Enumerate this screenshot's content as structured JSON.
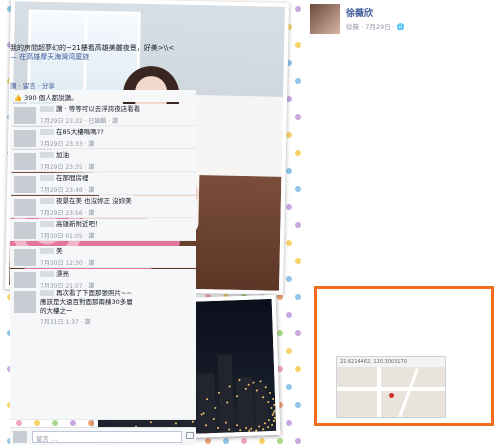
{
  "post": {
    "author": "徐薇欣",
    "meta": "徐薇 · 7月29日 · 🌐",
    "text": "我的房間超夢幻的~21樓看高雄美麗夜景，好美>\\\\<",
    "place": "— 在高雄摩天海灣湾廈旅",
    "actions": "讚 · 留言 · 分享",
    "likes": "390 個人都說讚。"
  },
  "comments": [
    {
      "text": "讚 · 等等可以去浮誇夜店看看",
      "meta": "7月29日 23:32 · 已編輯 · 讚"
    },
    {
      "text": "在85大樓嗎嗎??",
      "meta": "7月29日 23:33 · 讚"
    },
    {
      "text": "加油",
      "meta": "7月29日 23:35 · 讚"
    },
    {
      "text": "在那間房裡",
      "meta": "7月29日 23:48 · 讚"
    },
    {
      "text": "夜景在美 也沒妳正 沒妳美",
      "meta": "7月29日 23:56 · 讚"
    },
    {
      "text": "高雄新附近吧！",
      "meta": "7月30日 01:05 · 讚"
    },
    {
      "text": "美",
      "meta": "7月30日 12:30 · 讚"
    },
    {
      "text": "漂亮",
      "meta": "7月30日 21:07 · 讚"
    }
  ],
  "highlight_comment": {
    "line1": "再次看了下面那張照片~~",
    "line2": "應該是大遠百對面那兩棟30多層",
    "line3": "的大樓之一",
    "meta": "7月31日 1:37 · 讚"
  },
  "map": {
    "bar_text": "22.6214462, 120.3003170"
  },
  "reply": {
    "placeholder": "留言 ..."
  },
  "colors": {
    "link": "#3b5998",
    "highlight": "#f26e1c",
    "meta_gray": "#9197a3"
  }
}
